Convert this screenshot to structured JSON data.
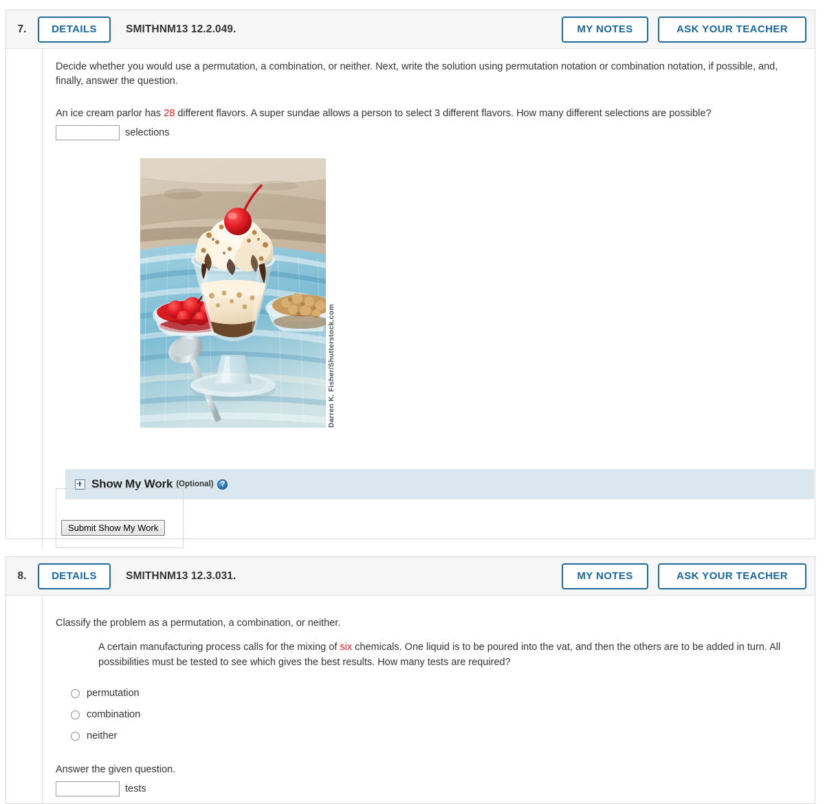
{
  "questions": [
    {
      "number": "7.",
      "details_label": "DETAILS",
      "code": "SMITHNM13 12.2.049.",
      "my_notes_label": "MY NOTES",
      "ask_teacher_label": "ASK YOUR TEACHER",
      "instructions": "Decide whether you would use a permutation, a combination, or neither. Next, write the solution using permutation notation or combination notation, if possible, and, finally, answer the question.",
      "problem_prefix": "An ice cream parlor has ",
      "problem_number": "28",
      "problem_suffix": " different flavors. A super sundae allows a person to select 3 different flavors. How many different selections are possible?",
      "answer_value": "",
      "answer_unit": "selections",
      "figure_credit": "Darren K. Fisher/Shutterstock.com",
      "show_my_work": {
        "title": "Show My Work",
        "optional": "(Optional)",
        "help": "?",
        "submit_label": "Submit Show My Work"
      }
    },
    {
      "number": "8.",
      "details_label": "DETAILS",
      "code": "SMITHNM13 12.3.031.",
      "my_notes_label": "MY NOTES",
      "ask_teacher_label": "ASK YOUR TEACHER",
      "instructions": "Classify the problem as a permutation, a combination, or neither.",
      "problem_prefix": "A certain manufacturing process calls for the mixing of ",
      "problem_number": "six",
      "problem_suffix": " chemicals. One liquid is to be poured into the vat, and then the others are to be added in turn. All possibilities must be tested to see which gives the best results. How many tests are required?",
      "choices": [
        {
          "label": "permutation",
          "selected": false
        },
        {
          "label": "combination",
          "selected": false
        },
        {
          "label": "neither",
          "selected": false
        }
      ],
      "answer_prompt": "Answer the given question.",
      "answer_value": "",
      "answer_unit": "tests"
    }
  ],
  "colors": {
    "accent": "#1a6699",
    "highlight_red": "#e8191c",
    "show_my_work_bg": "#dbe7ef",
    "header_bg": "#f6f6f6"
  }
}
